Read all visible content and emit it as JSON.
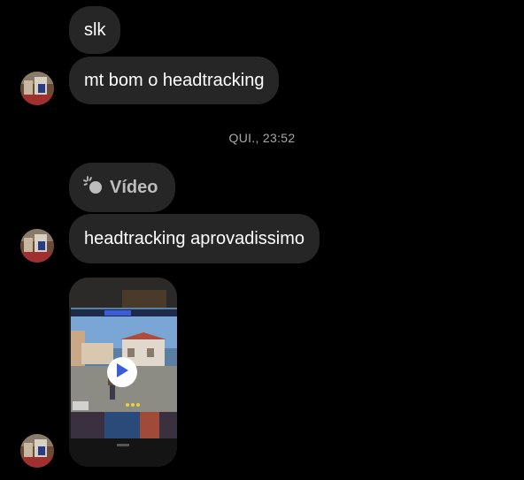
{
  "messages": [
    {
      "text": "slk"
    },
    {
      "text": "mt bom o headtracking"
    },
    {
      "text": "headtracking aprovadissimo"
    }
  ],
  "timestamp": "QUI., 23:52",
  "video_label": {
    "icon": "sparkle-circle-icon",
    "text": "Vídeo"
  },
  "video_attachment": {
    "icon": "play-icon",
    "accent": "#3b5bdb"
  },
  "colors": {
    "background": "#000000",
    "bubble": "#262626",
    "text": "#ffffff",
    "timestamp": "#a8a8a8"
  }
}
